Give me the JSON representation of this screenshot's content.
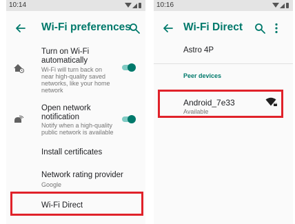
{
  "left_screen": {
    "status_time": "10:14",
    "title": "Wi-Fi preferences",
    "items": [
      {
        "title_line1": "Turn on Wi-Fi",
        "title_line2": "automatically",
        "sub_lines": [
          "Wi-Fi will turn back on",
          "near high-quality saved",
          "networks, like your home",
          "network"
        ],
        "toggle_on": true
      },
      {
        "title_line1": "Open network",
        "title_line2": "notification",
        "sub_lines": [
          "Notify when a high-quality",
          "public network is available"
        ],
        "toggle_on": true
      },
      {
        "title": "Install certificates"
      },
      {
        "title": "Network rating provider",
        "subtitle": "Google"
      },
      {
        "title": "Wi-Fi Direct"
      }
    ]
  },
  "right_screen": {
    "status_time": "10:16",
    "title": "Wi-Fi Direct",
    "device_name": "Astro 4P",
    "section_label": "Peer devices",
    "peer": {
      "name": "Android_7e33",
      "status": "Available"
    }
  },
  "colors": {
    "accent": "#00796b",
    "toggle_track": "#80cbc4",
    "toggle_thumb": "#00796b",
    "highlight": "#e0222a"
  }
}
